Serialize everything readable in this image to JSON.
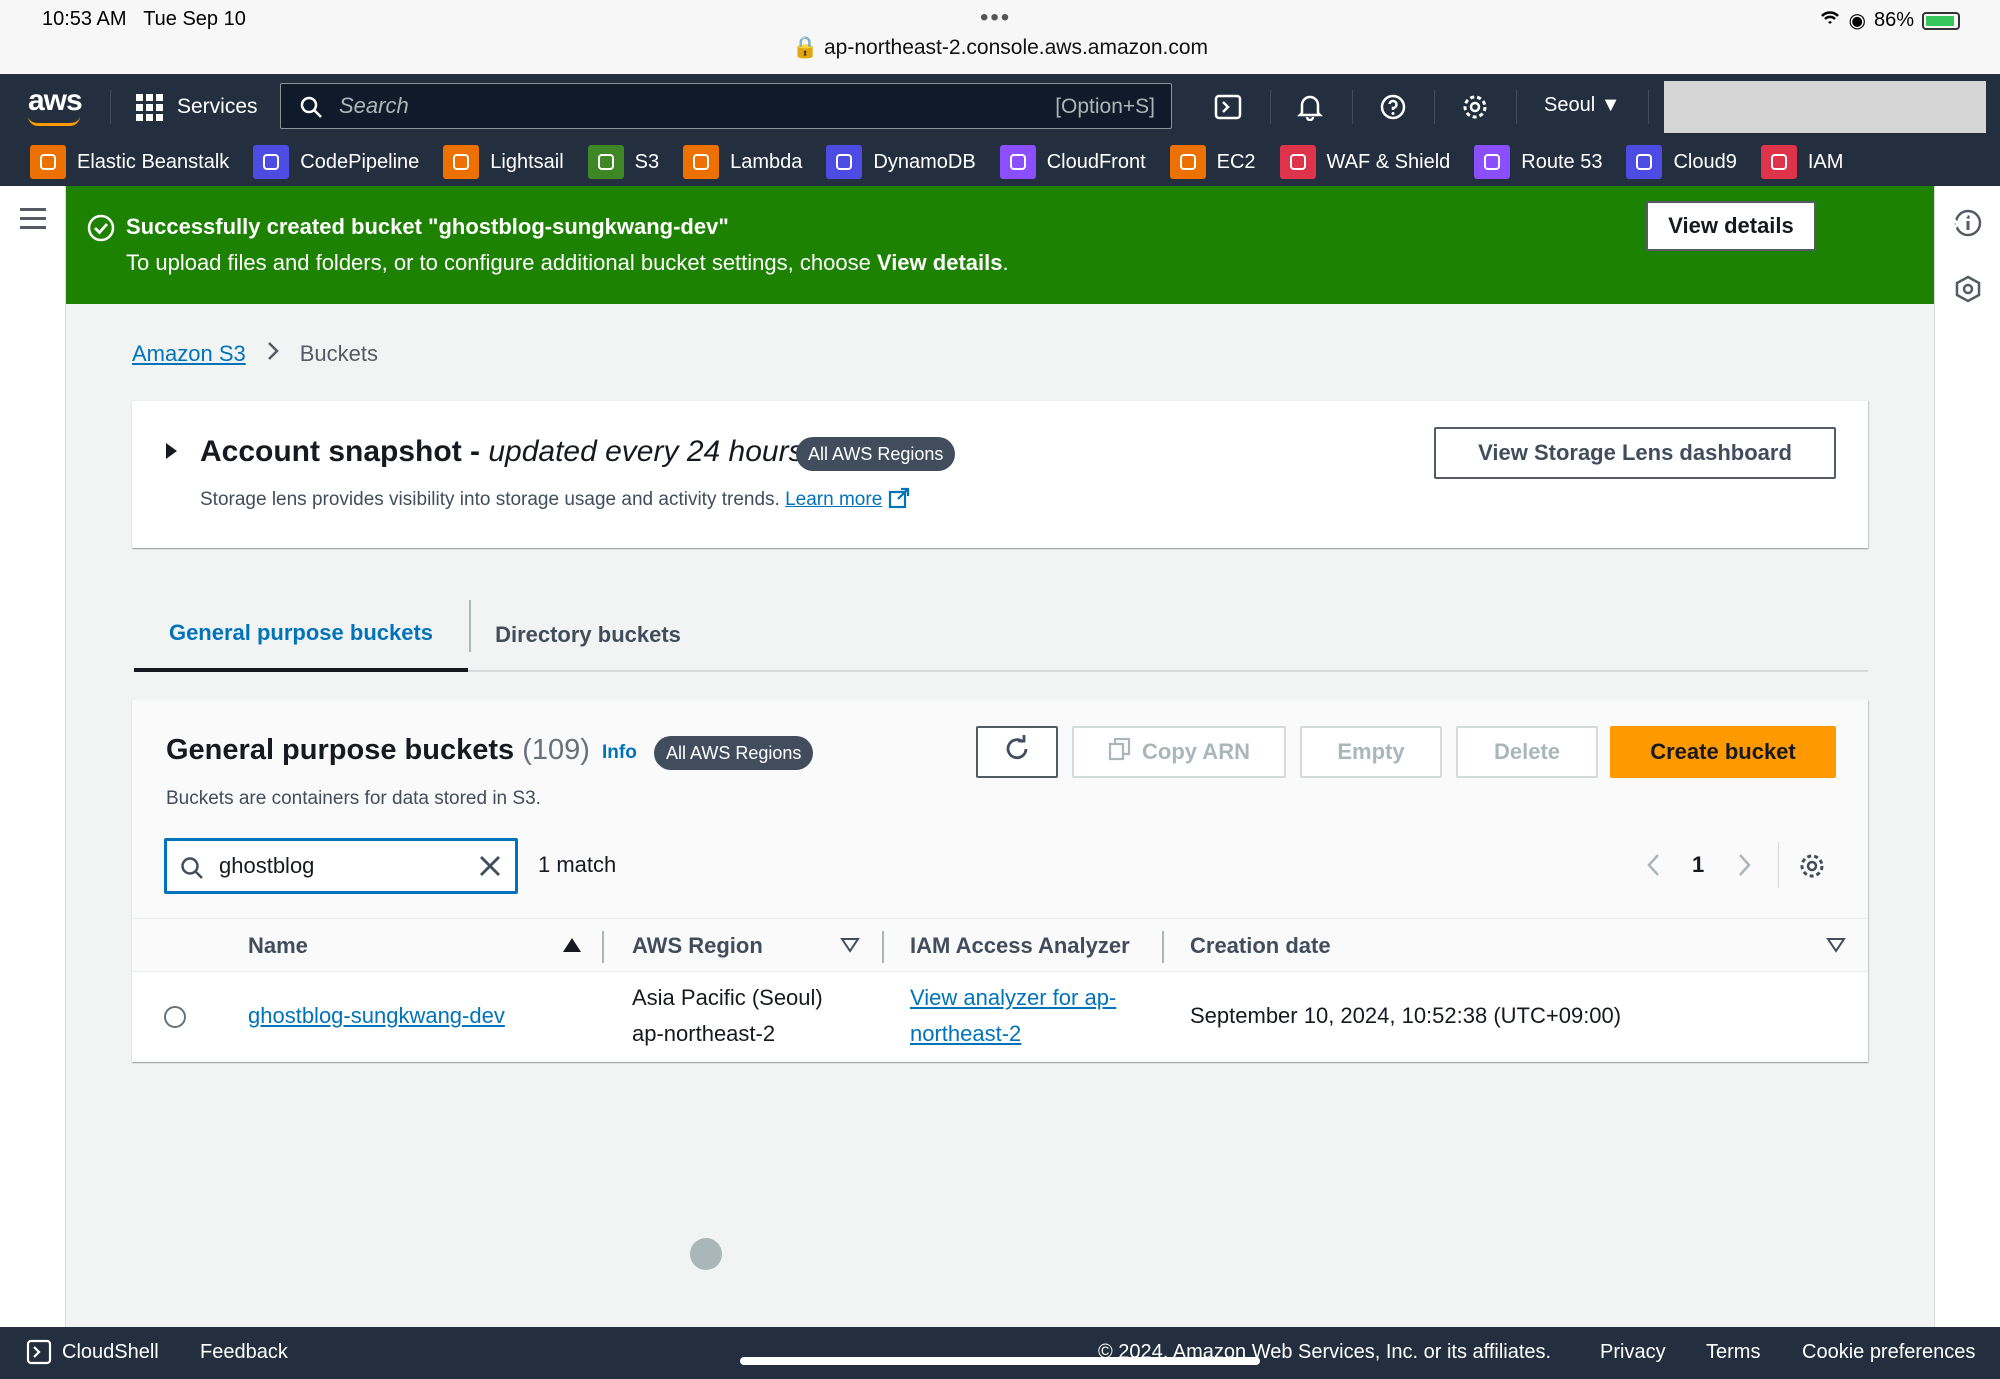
{
  "status_bar": {
    "time": "10:53 AM",
    "date": "Tue Sep 10",
    "battery": "86%",
    "url": "ap-northeast-2.console.aws.amazon.com"
  },
  "topnav": {
    "logo": "aws",
    "services_label": "Services",
    "search_placeholder": "Search",
    "search_shortcut": "[Option+S]",
    "region": "Seoul ▼"
  },
  "favorites": [
    {
      "label": "Elastic Beanstalk",
      "icon": "elastic-beanstalk-icon",
      "color": "#ed7100"
    },
    {
      "label": "CodePipeline",
      "icon": "codepipeline-icon",
      "color": "#4d4ce2"
    },
    {
      "label": "Lightsail",
      "icon": "lightsail-icon",
      "color": "#ed7100"
    },
    {
      "label": "S3",
      "icon": "s3-icon",
      "color": "#3f8624"
    },
    {
      "label": "Lambda",
      "icon": "lambda-icon",
      "color": "#ed7100"
    },
    {
      "label": "DynamoDB",
      "icon": "dynamodb-icon",
      "color": "#4d4ce2"
    },
    {
      "label": "CloudFront",
      "icon": "cloudfront-icon",
      "color": "#8c4fff"
    },
    {
      "label": "EC2",
      "icon": "ec2-icon",
      "color": "#ed7100"
    },
    {
      "label": "WAF & Shield",
      "icon": "waf-icon",
      "color": "#dd344c"
    },
    {
      "label": "Route 53",
      "icon": "route53-icon",
      "color": "#8c4fff"
    },
    {
      "label": "Cloud9",
      "icon": "cloud9-icon",
      "color": "#4d4ce2"
    },
    {
      "label": "IAM",
      "icon": "iam-icon",
      "color": "#dd344c"
    }
  ],
  "flash": {
    "title": "Successfully created bucket \"ghostblog-sungkwang-dev\"",
    "message_prefix": "To upload files and folders, or to configure additional bucket settings, choose ",
    "message_bold": "View details",
    "message_suffix": ".",
    "button": "View details",
    "color": "#1d8102"
  },
  "breadcrumb": {
    "root": "Amazon S3",
    "current": "Buckets"
  },
  "snapshot": {
    "title": "Account snapshot - ",
    "subtitle": "updated every 24 hours",
    "badge": "All AWS Regions",
    "description": "Storage lens provides visibility into storage usage and activity trends. ",
    "learn_more": "Learn more",
    "button": "View Storage Lens dashboard"
  },
  "tabs": [
    {
      "label": "General purpose buckets",
      "active": true
    },
    {
      "label": "Directory buckets",
      "active": false
    }
  ],
  "buckets_panel": {
    "title": "General purpose buckets",
    "count": "(109)",
    "info": "Info",
    "badge": "All AWS Regions",
    "description": "Buckets are containers for data stored in S3.",
    "copy_arn": "Copy ARN",
    "empty": "Empty",
    "delete": "Delete",
    "create": "Create bucket",
    "filter_value": "ghostblog",
    "match_text": "1 match",
    "page": "1",
    "columns": [
      "Name",
      "AWS Region",
      "IAM Access Analyzer",
      "Creation date"
    ],
    "rows": [
      {
        "name": "ghostblog-sungkwang-dev",
        "region_line1": "Asia Pacific (Seoul)",
        "region_line2": "ap-northeast-2",
        "analyzer_line1": "View analyzer for ap-",
        "analyzer_line2": "northeast-2",
        "created": "September 10, 2024, 10:52:38 (UTC+09:00)"
      }
    ]
  },
  "footer": {
    "cloudshell": "CloudShell",
    "feedback": "Feedback",
    "copyright": "© 2024, Amazon Web Services, Inc. or its affiliates.",
    "privacy": "Privacy",
    "terms": "Terms",
    "cookies": "Cookie preferences"
  },
  "colors": {
    "accent": "#ff9900",
    "link": "#0073bb",
    "nav_bg": "#232f3e"
  }
}
